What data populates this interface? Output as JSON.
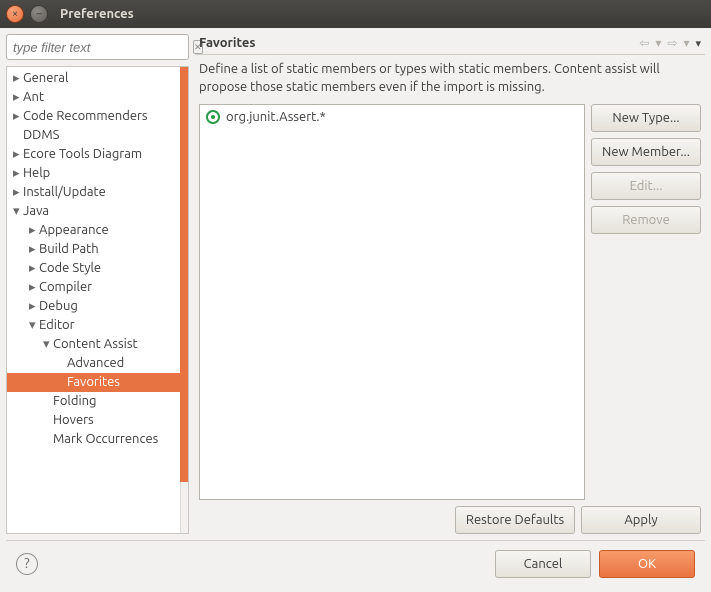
{
  "window": {
    "title": "Preferences"
  },
  "filter": {
    "placeholder": "type filter text"
  },
  "tree": [
    {
      "label": "General",
      "depth": 0,
      "expandable": true,
      "expanded": false
    },
    {
      "label": "Ant",
      "depth": 0,
      "expandable": true,
      "expanded": false
    },
    {
      "label": "Code Recommenders",
      "depth": 0,
      "expandable": true,
      "expanded": false
    },
    {
      "label": "DDMS",
      "depth": 0,
      "expandable": false,
      "expanded": false
    },
    {
      "label": "Ecore Tools Diagram",
      "depth": 0,
      "expandable": true,
      "expanded": false
    },
    {
      "label": "Help",
      "depth": 0,
      "expandable": true,
      "expanded": false
    },
    {
      "label": "Install/Update",
      "depth": 0,
      "expandable": true,
      "expanded": false
    },
    {
      "label": "Java",
      "depth": 0,
      "expandable": true,
      "expanded": true
    },
    {
      "label": "Appearance",
      "depth": 1,
      "expandable": true,
      "expanded": false
    },
    {
      "label": "Build Path",
      "depth": 1,
      "expandable": true,
      "expanded": false
    },
    {
      "label": "Code Style",
      "depth": 1,
      "expandable": true,
      "expanded": false
    },
    {
      "label": "Compiler",
      "depth": 1,
      "expandable": true,
      "expanded": false
    },
    {
      "label": "Debug",
      "depth": 1,
      "expandable": true,
      "expanded": false
    },
    {
      "label": "Editor",
      "depth": 1,
      "expandable": true,
      "expanded": true
    },
    {
      "label": "Content Assist",
      "depth": 2,
      "expandable": true,
      "expanded": true
    },
    {
      "label": "Advanced",
      "depth": 3,
      "expandable": false,
      "expanded": false
    },
    {
      "label": "Favorites",
      "depth": 3,
      "expandable": false,
      "expanded": false,
      "selected": true
    },
    {
      "label": "Folding",
      "depth": 2,
      "expandable": false,
      "expanded": false
    },
    {
      "label": "Hovers",
      "depth": 2,
      "expandable": false,
      "expanded": false
    },
    {
      "label": "Mark Occurrences",
      "depth": 2,
      "expandable": false,
      "expanded": false
    }
  ],
  "page": {
    "title": "Favorites",
    "description": "Define a list of static members or types with static members. Content assist will propose those static members even if the import is missing.",
    "items": [
      {
        "text": "org.junit.Assert.*",
        "icon": "type-icon"
      }
    ],
    "buttons": {
      "new_type": "New Type...",
      "new_member": "New Member...",
      "edit": "Edit...",
      "remove": "Remove",
      "restore": "Restore Defaults",
      "apply": "Apply"
    }
  },
  "footer": {
    "cancel": "Cancel",
    "ok": "OK"
  }
}
